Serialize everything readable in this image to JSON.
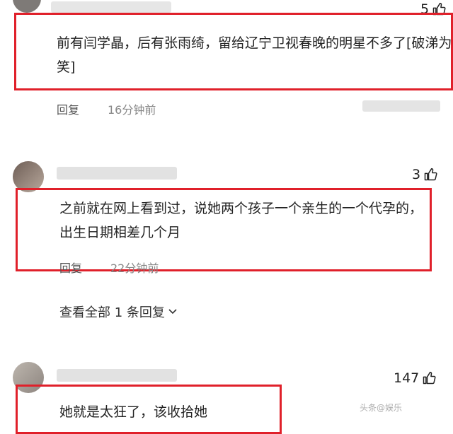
{
  "comments": [
    {
      "text": "前有闫学晶，后有张雨绮，留给辽宁卫视春晚的明星不多了[破涕为笑]",
      "like_count": "5",
      "reply_label": "回复",
      "time": "16分钟前"
    },
    {
      "text": "之前就在网上看到过，说她两个孩子一个亲生的一个代孕的，出生日期相差几个月",
      "like_count": "3",
      "reply_label": "回复",
      "time": "22分钟前",
      "view_replies": "查看全部 1 条回复"
    },
    {
      "text": "她就是太狂了，该收拾她",
      "like_count": "147"
    }
  ],
  "watermark": "头条@娱乐"
}
